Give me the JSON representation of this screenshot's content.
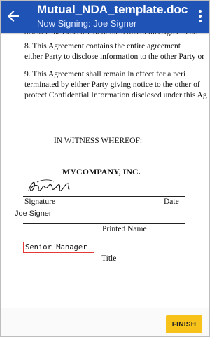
{
  "appbar": {
    "title": "Mutual_NDA_template.doc",
    "subtitle": "Now Signing: Joe Signer"
  },
  "document": {
    "cut_line": "disclose the existence of or the terms of this Agreement.",
    "para8_line1": "8.        This Agreement contains the entire agreement",
    "para8_line2": "either Party to disclose information to the other Party or",
    "para9_line1": "9.        This Agreement shall remain in effect for a peri",
    "para9_line2": "terminated by either Party giving notice to the other of",
    "para9_line3": "protect Confidential Information disclosed under this Ag",
    "witness": "IN WITNESS WHEREOF:",
    "company": "MYCOMPANY, INC.",
    "signature_label": "Signature",
    "date_label": "Date",
    "printed_name_value": "Joe Signer",
    "printed_name_label": "Printed Name",
    "title_value": "Senior Manager",
    "title_label": "Title"
  },
  "bottom": {
    "finish_label": "FINISH"
  },
  "colors": {
    "appbar": "#1f53b5",
    "finish": "#f7c21a",
    "field_border": "#e53935"
  },
  "icons": {
    "back": "arrow-left-icon",
    "menu": "more-vert-icon"
  }
}
